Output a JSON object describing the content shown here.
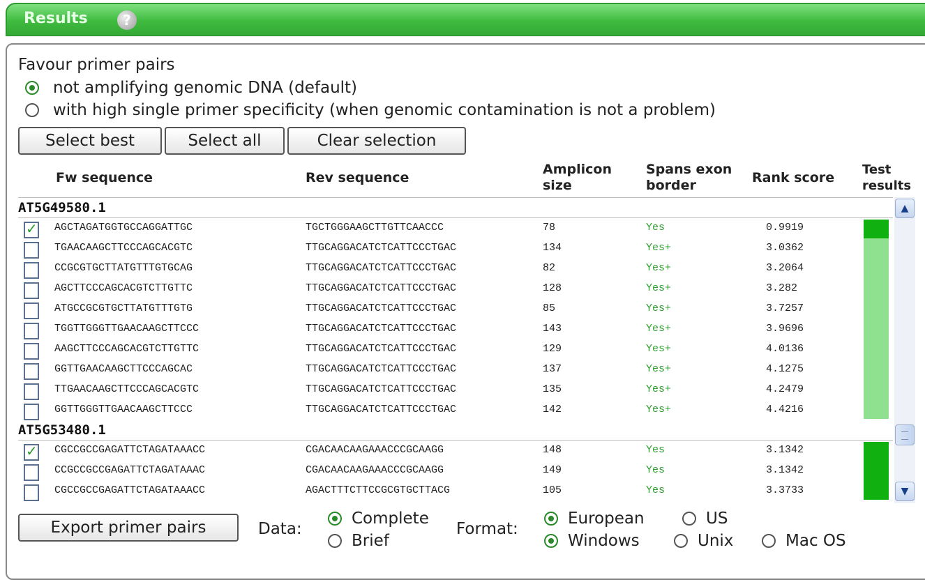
{
  "header": {
    "title": "Results",
    "help": "?"
  },
  "favour": {
    "title": "Favour primer pairs",
    "options": [
      {
        "label": "not amplifying genomic DNA (default)",
        "checked": true
      },
      {
        "label": "with high single primer specificity (when genomic contamination is not a problem)",
        "checked": false
      }
    ]
  },
  "buttons": {
    "select_best": "Select best",
    "select_all": "Select all",
    "clear_selection": "Clear selection",
    "export": "Export primer pairs"
  },
  "table": {
    "headers": {
      "fw": "Fw sequence",
      "rev": "Rev sequence",
      "amplicon_1": "Amplicon",
      "amplicon_2": "size",
      "spans_1": "Spans exon",
      "spans_2": "border",
      "rank": "Rank score",
      "test_1": "Test",
      "test_2": "results"
    },
    "groups": [
      {
        "name": "AT5G49580.1",
        "rows": [
          {
            "checked": true,
            "fw": "AGCTAGATGGTGCCAGGATTGC",
            "rev": "TGCTGGGAAGCTTGTTCAACCC",
            "size": "78",
            "spans": "Yes",
            "rank": "0.9919"
          },
          {
            "checked": false,
            "fw": "TGAACAAGCTTCCCAGCACGTC",
            "rev": "TTGCAGGACATCTCATTCCCTGAC",
            "size": "134",
            "spans": "Yes+",
            "rank": "3.0362"
          },
          {
            "checked": false,
            "fw": "CCGCGTGCTTATGTTTGTGCAG",
            "rev": "TTGCAGGACATCTCATTCCCTGAC",
            "size": "82",
            "spans": "Yes+",
            "rank": "3.2064"
          },
          {
            "checked": false,
            "fw": "AGCTTCCCAGCACGTCTTGTTC",
            "rev": "TTGCAGGACATCTCATTCCCTGAC",
            "size": "128",
            "spans": "Yes+",
            "rank": "3.282"
          },
          {
            "checked": false,
            "fw": "ATGCCGCGTGCTTATGTTTGTG",
            "rev": "TTGCAGGACATCTCATTCCCTGAC",
            "size": "85",
            "spans": "Yes+",
            "rank": "3.7257"
          },
          {
            "checked": false,
            "fw": "TGGTTGGGTTGAACAAGCTTCCC",
            "rev": "TTGCAGGACATCTCATTCCCTGAC",
            "size": "143",
            "spans": "Yes+",
            "rank": "3.9696"
          },
          {
            "checked": false,
            "fw": "AAGCTTCCCAGCACGTCTTGTTC",
            "rev": "TTGCAGGACATCTCATTCCCTGAC",
            "size": "129",
            "spans": "Yes+",
            "rank": "4.0136"
          },
          {
            "checked": false,
            "fw": "GGTTGAACAAGCTTCCCAGCAC",
            "rev": "TTGCAGGACATCTCATTCCCTGAC",
            "size": "137",
            "spans": "Yes+",
            "rank": "4.1275"
          },
          {
            "checked": false,
            "fw": "TTGAACAAGCTTCCCAGCACGTC",
            "rev": "TTGCAGGACATCTCATTCCCTGAC",
            "size": "135",
            "spans": "Yes+",
            "rank": "4.2479"
          },
          {
            "checked": false,
            "fw": "GGTTGGGTTGAACAAGCTTCCC",
            "rev": "TTGCAGGACATCTCATTCCCTGAC",
            "size": "142",
            "spans": "Yes+",
            "rank": "4.4216"
          }
        ]
      },
      {
        "name": "AT5G53480.1",
        "rows": [
          {
            "checked": true,
            "fw": "CGCCGCCGAGATTCTAGATAAACC",
            "rev": "CGACAACAAGAAACCCGCAAGG",
            "size": "148",
            "spans": "Yes",
            "rank": "3.1342"
          },
          {
            "checked": false,
            "fw": "CCGCCGCCGAGATTCTAGATAAAC",
            "rev": "CGACAACAAGAAACCCGCAAGG",
            "size": "149",
            "spans": "Yes",
            "rank": "3.1342"
          },
          {
            "checked": false,
            "fw": "CGCCGCCGAGATTCTAGATAAACC",
            "rev": "AGACTTTCTTCCGCGTGCTTACG",
            "size": "105",
            "spans": "Yes",
            "rank": "3.3733"
          }
        ]
      }
    ]
  },
  "export": {
    "data_label": "Data:",
    "data_options": [
      {
        "label": "Complete",
        "checked": true
      },
      {
        "label": "Brief",
        "checked": false
      }
    ],
    "format_label": "Format:",
    "locale_options": [
      {
        "label": "European",
        "checked": true
      },
      {
        "label": "US",
        "checked": false
      }
    ],
    "os_options": [
      {
        "label": "Windows",
        "checked": true
      },
      {
        "label": "Unix",
        "checked": false
      },
      {
        "label": "Mac OS",
        "checked": false
      }
    ]
  },
  "colors": {
    "header_green": "#3fbb3f",
    "test_dark": "#0fb00f",
    "test_light": "#8fe08f",
    "yes_text": "#2ea02e"
  },
  "icons": {
    "help": "help-icon",
    "scroll_up": "chevron-up-icon",
    "scroll_down": "chevron-down-icon",
    "checkbox_check": "check-icon"
  }
}
